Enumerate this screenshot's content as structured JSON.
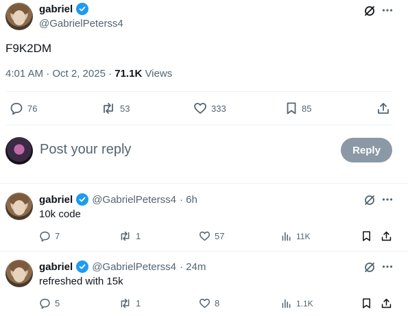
{
  "main_tweet": {
    "name": "gabriel",
    "handle": "@GabrielPeterss4",
    "text": "F9K2DM",
    "time": "4:01 AM · Oct 2, 2025 · ",
    "views_count": "71.1K",
    "views_label": " Views",
    "replies": "76",
    "reposts": "53",
    "likes": "333",
    "bookmarks": "85"
  },
  "composer": {
    "placeholder": "Post your reply",
    "reply_label": "Reply"
  },
  "replies": [
    {
      "name": "gabriel",
      "handle": "@GabrielPeterss4",
      "time": "· 6h",
      "text": "10k code",
      "replies": "7",
      "reposts": "1",
      "likes": "57",
      "views": "11K"
    },
    {
      "name": "gabriel",
      "handle": "@GabrielPeterss4",
      "time": "· 24m",
      "text": "refreshed with 15k",
      "replies": "5",
      "reposts": "1",
      "likes": "8",
      "views": "1.1K"
    }
  ],
  "icons": {
    "verified": "verified-badge-icon",
    "grok": "grok-icon",
    "more": "more-icon",
    "reply": "reply-icon",
    "repost": "repost-icon",
    "like": "heart-icon",
    "bookmark": "bookmark-icon",
    "share": "share-icon",
    "views": "views-icon"
  },
  "colors": {
    "accent": "#1d9bf0",
    "reply_button": "#8b98a5",
    "muted_text": "#536471"
  }
}
